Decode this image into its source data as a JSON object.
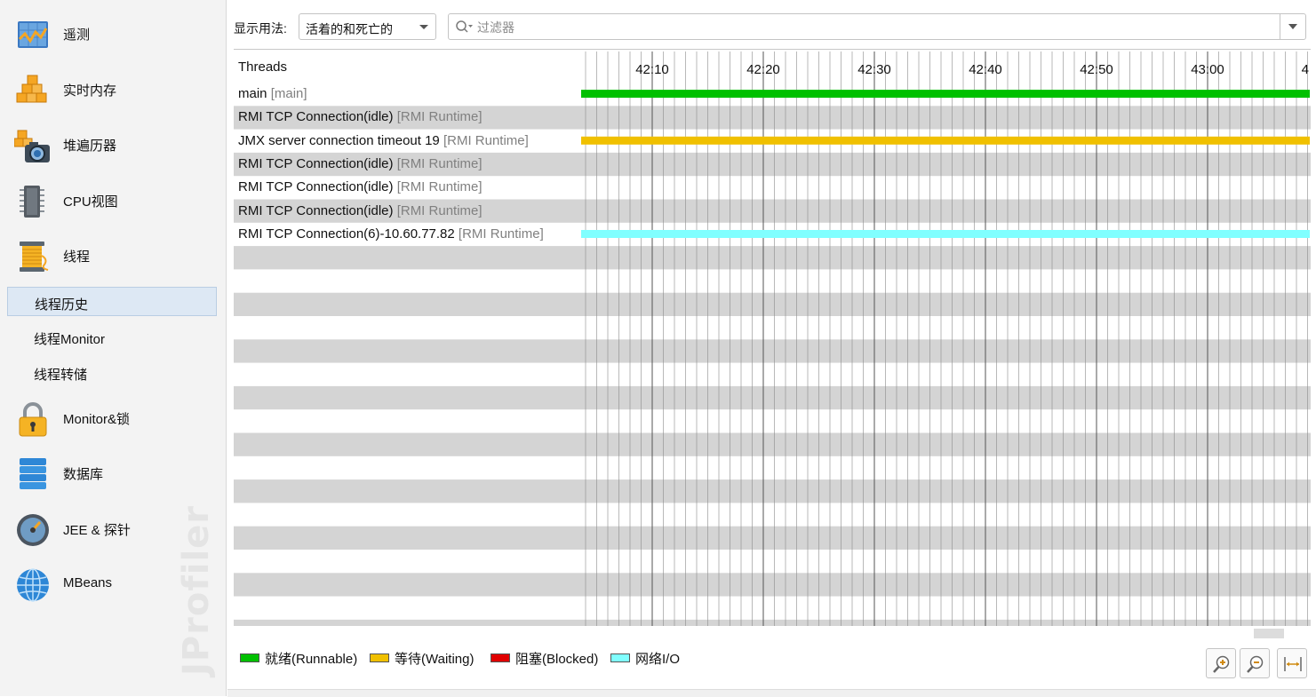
{
  "sidebar": {
    "items": [
      {
        "label": "遥测",
        "icon": "telemetry-icon"
      },
      {
        "label": "实时内存",
        "icon": "live-memory-icon"
      },
      {
        "label": "堆遍历器",
        "icon": "heap-walker-icon"
      },
      {
        "label": "CPU视图",
        "icon": "cpu-chip-icon"
      },
      {
        "label": "线程",
        "icon": "thread-spool-icon"
      },
      {
        "label": "Monitor&锁",
        "icon": "padlock-icon"
      },
      {
        "label": "数据库",
        "icon": "database-icon"
      },
      {
        "label": "JEE & 探针",
        "icon": "probe-gauge-icon"
      },
      {
        "label": "MBeans",
        "icon": "globe-icon"
      }
    ],
    "thread_subitems": [
      {
        "label": "线程历史",
        "selected": true
      },
      {
        "label": "线程Monitor",
        "selected": false
      },
      {
        "label": "线程转储",
        "selected": false
      }
    ],
    "brand": "JProfiler"
  },
  "toolbar": {
    "display_label": "显示用法:",
    "display_value": "活着的和死亡的",
    "filter_placeholder": "过滤器"
  },
  "threads": {
    "header": "Threads",
    "rows": [
      {
        "name": "main",
        "group": "[main]",
        "state": "runnable"
      },
      {
        "name": "RMI TCP Connection(idle)",
        "group": "[RMI Runtime]",
        "state": "none"
      },
      {
        "name": "JMX server connection timeout 19",
        "group": "[RMI Runtime]",
        "state": "waiting"
      },
      {
        "name": "RMI TCP Connection(idle)",
        "group": "[RMI Runtime]",
        "state": "none"
      },
      {
        "name": "RMI TCP Connection(idle)",
        "group": "[RMI Runtime]",
        "state": "none"
      },
      {
        "name": "RMI TCP Connection(idle)",
        "group": "[RMI Runtime]",
        "state": "none"
      },
      {
        "name": "RMI TCP Connection(6)-10.60.77.82",
        "group": "[RMI Runtime]",
        "state": "net_io"
      }
    ]
  },
  "timeline": {
    "tick_labels": [
      "42:10",
      "42:20",
      "42:30",
      "42:40",
      "42:50",
      "43:00",
      "4"
    ]
  },
  "legend": [
    {
      "label": "就绪(Runnable)",
      "color": "#00c000"
    },
    {
      "label": "等待(Waiting)",
      "color": "#f0c000"
    },
    {
      "label": "阻塞(Blocked)",
      "color": "#e00000"
    },
    {
      "label": "网络I/O",
      "color": "#80ffff"
    }
  ],
  "colors": {
    "runnable": "#00c000",
    "waiting": "#f0c000",
    "blocked": "#e00000",
    "net_io": "#80ffff",
    "stripe": "#d4d4d4",
    "selection": "#dde8f4"
  },
  "zoom": {
    "buttons": [
      "zoom-in-icon",
      "zoom-out-icon",
      "fit-width-icon"
    ]
  }
}
